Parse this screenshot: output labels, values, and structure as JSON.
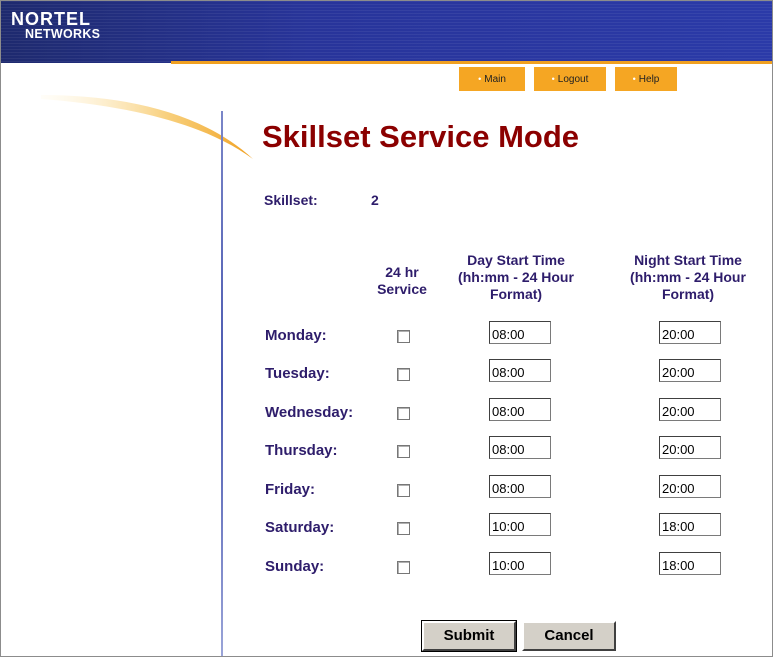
{
  "brand": {
    "top": "NORTEL",
    "bottom": "NETWORKS"
  },
  "nav": [
    {
      "label": "Main"
    },
    {
      "label": "Logout"
    },
    {
      "label": "Help"
    }
  ],
  "page_title": "Skillset Service Mode",
  "skillset": {
    "label": "Skillset:",
    "value": "2"
  },
  "columns": {
    "service": [
      "24 hr",
      "Service"
    ],
    "day": [
      "Day Start Time",
      "(hh:mm - 24 Hour",
      "Format)"
    ],
    "night": [
      "Night Start Time",
      "(hh:mm - 24 Hour",
      "Format)"
    ]
  },
  "rows": [
    {
      "day": "Monday:",
      "checked": false,
      "day_start": "08:00",
      "night_start": "20:00"
    },
    {
      "day": "Tuesday:",
      "checked": false,
      "day_start": "08:00",
      "night_start": "20:00"
    },
    {
      "day": "Wednesday:",
      "checked": false,
      "day_start": "08:00",
      "night_start": "20:00"
    },
    {
      "day": "Thursday:",
      "checked": false,
      "day_start": "08:00",
      "night_start": "20:00"
    },
    {
      "day": "Friday:",
      "checked": false,
      "day_start": "08:00",
      "night_start": "20:00"
    },
    {
      "day": "Saturday:",
      "checked": false,
      "day_start": "10:00",
      "night_start": "18:00"
    },
    {
      "day": "Sunday:",
      "checked": false,
      "day_start": "10:00",
      "night_start": "18:00"
    }
  ],
  "buttons": {
    "submit": "Submit",
    "cancel": "Cancel"
  },
  "colors": {
    "title": "#8b0000",
    "label": "#2e1d6b",
    "nav": "#f5a623",
    "header": "#28349a"
  }
}
